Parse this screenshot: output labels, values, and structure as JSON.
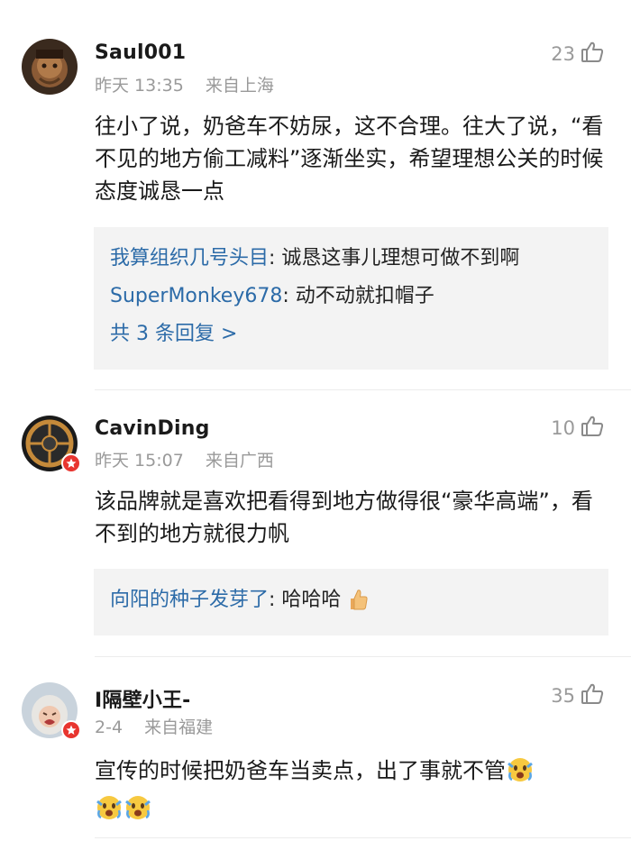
{
  "comments": [
    {
      "username": "Saul001",
      "time": "昨天 13:35",
      "location": "来自上海",
      "likes": "23",
      "text": "往小了说，奶爸车不妨尿，这不合理。往大了说，“看不见的地方偷工减料”逐渐坐实，希望理想公关的时候态度诚恳一点",
      "replies": [
        {
          "user": "我算组织几号头目",
          "text": ": 诚恳这事儿理想可做不到啊"
        },
        {
          "user": "SuperMonkey678",
          "text": ": 动不动就扣帽子"
        }
      ],
      "more": "共 3 条回复 >"
    },
    {
      "username": "CavinDing",
      "time": "昨天 15:07",
      "location": "来自广西",
      "likes": "10",
      "text": "该品牌就是喜欢把看得到地方做得很“豪华高端”，看不到的地方就很力帆",
      "replies": [
        {
          "user": "向阳的种子发芽了",
          "text": ": 哈哈哈"
        }
      ]
    },
    {
      "username": "I隔壁小王-",
      "time": "2-4",
      "location": "来自福建",
      "likes": "35",
      "text": "宣传的时候把奶爸车当卖点，出了事就不管"
    }
  ],
  "colors": {
    "link": "#2c6ba8",
    "meta": "#9a9a9a",
    "reply_bg": "#f3f3f3",
    "badge": "#e8352f"
  },
  "icons": [
    "thumbs-up-icon",
    "verified-badge-icon",
    "thumbs-up-emoji",
    "shocked-crying-emoji"
  ]
}
